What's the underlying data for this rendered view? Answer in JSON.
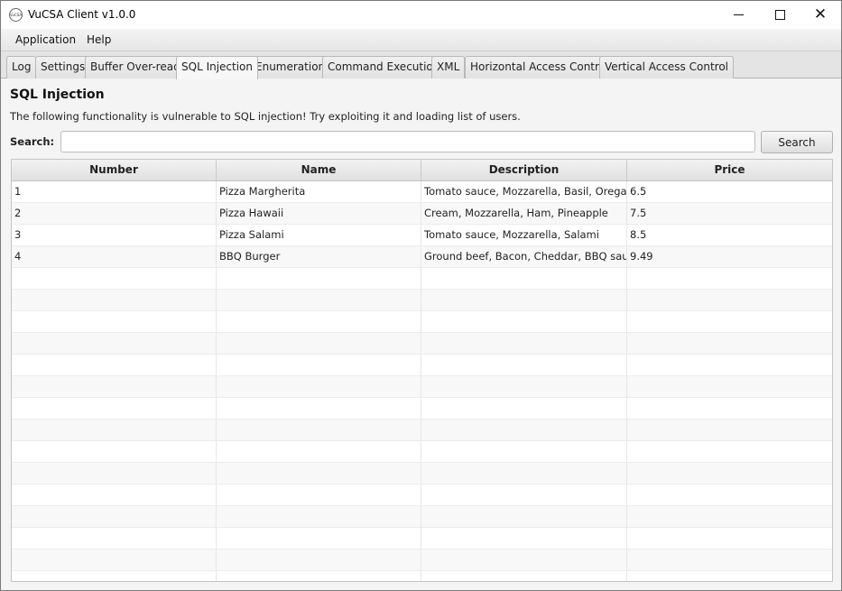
{
  "window": {
    "title": "VuCSA Client v1.0.0",
    "icon_label": "VuCSA"
  },
  "menu": {
    "items": [
      "Application",
      "Help"
    ]
  },
  "tabs": [
    {
      "label": "Log",
      "active": false
    },
    {
      "label": "Settings",
      "active": false
    },
    {
      "label": "Buffer Over-read",
      "active": false
    },
    {
      "label": "SQL Injection",
      "active": true
    },
    {
      "label": "Enumeration",
      "active": false
    },
    {
      "label": "Command Execution",
      "active": false
    },
    {
      "label": "XML",
      "active": false
    },
    {
      "label": "Horizontal Access Control",
      "active": false
    },
    {
      "label": "Vertical Access Control",
      "active": false
    }
  ],
  "panel": {
    "heading": "SQL Injection",
    "description": "The following functionality is vulnerable to SQL injection! Try exploiting it and loading list of users.",
    "search_label": "Search:",
    "search_value": "",
    "search_button": "Search"
  },
  "table": {
    "columns": [
      "Number",
      "Name",
      "Description",
      "Price"
    ],
    "rows": [
      [
        "1",
        "Pizza Margherita",
        "Tomato sauce, Mozzarella, Basil, Oregano",
        "6.5"
      ],
      [
        "2",
        "Pizza Hawaii",
        "Cream, Mozzarella, Ham, Pineapple",
        "7.5"
      ],
      [
        "3",
        "Pizza Salami",
        "Tomato sauce, Mozzarella, Salami",
        "8.5"
      ],
      [
        "4",
        "BBQ Burger",
        "Ground beef, Bacon, Cheddar, BBQ sauc...",
        "9.49"
      ]
    ],
    "empty_rows": 15
  }
}
